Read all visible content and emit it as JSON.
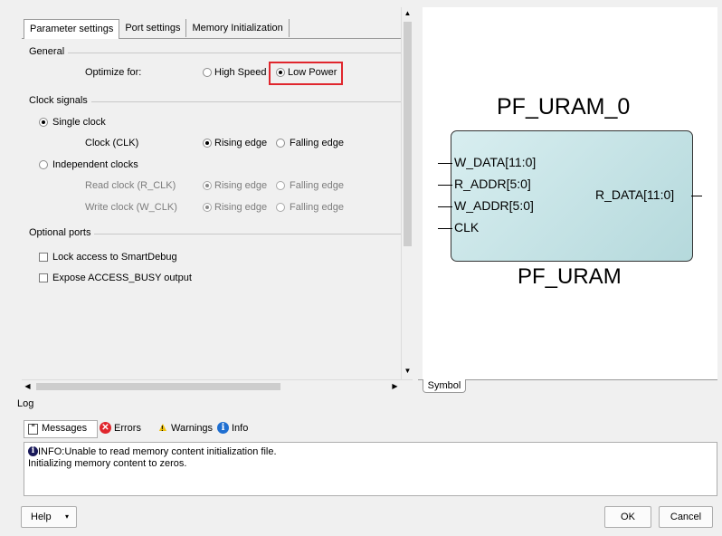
{
  "tabs": [
    "Parameter settings",
    "Port settings",
    "Memory Initialization"
  ],
  "general": {
    "label": "General",
    "optimize_label": "Optimize for:",
    "options": [
      "High Speed",
      "Low Power"
    ],
    "selected": "Low Power",
    "highlight_color": "#e0262d"
  },
  "clock": {
    "label": "Clock signals",
    "single_label": "Single clock",
    "clk_label": "Clock (CLK)",
    "rising": "Rising edge",
    "falling": "Falling edge",
    "independent_label": "Independent clocks",
    "read_label": "Read clock (R_CLK)",
    "write_label": "Write clock (W_CLK)"
  },
  "optional": {
    "label": "Optional ports",
    "lock_label": "Lock access to SmartDebug",
    "expose_label": "Expose  ACCESS_BUSY output"
  },
  "symbol": {
    "instance_name": "PF_URAM_0",
    "component_name": "PF_URAM",
    "inputs": [
      "W_DATA[11:0]",
      "R_ADDR[5:0]",
      "W_ADDR[5:0]",
      "CLK"
    ],
    "output": "R_DATA[11:0]",
    "tab_label": "Symbol"
  },
  "log": {
    "label": "Log",
    "tabs": [
      "Messages",
      "Errors",
      "Warnings",
      "Info"
    ],
    "message_line1": "INFO:Unable to read memory content initialization file.",
    "message_line2": "Initializing memory content to zeros."
  },
  "buttons": {
    "help": "Help",
    "ok": "OK",
    "cancel": "Cancel"
  }
}
